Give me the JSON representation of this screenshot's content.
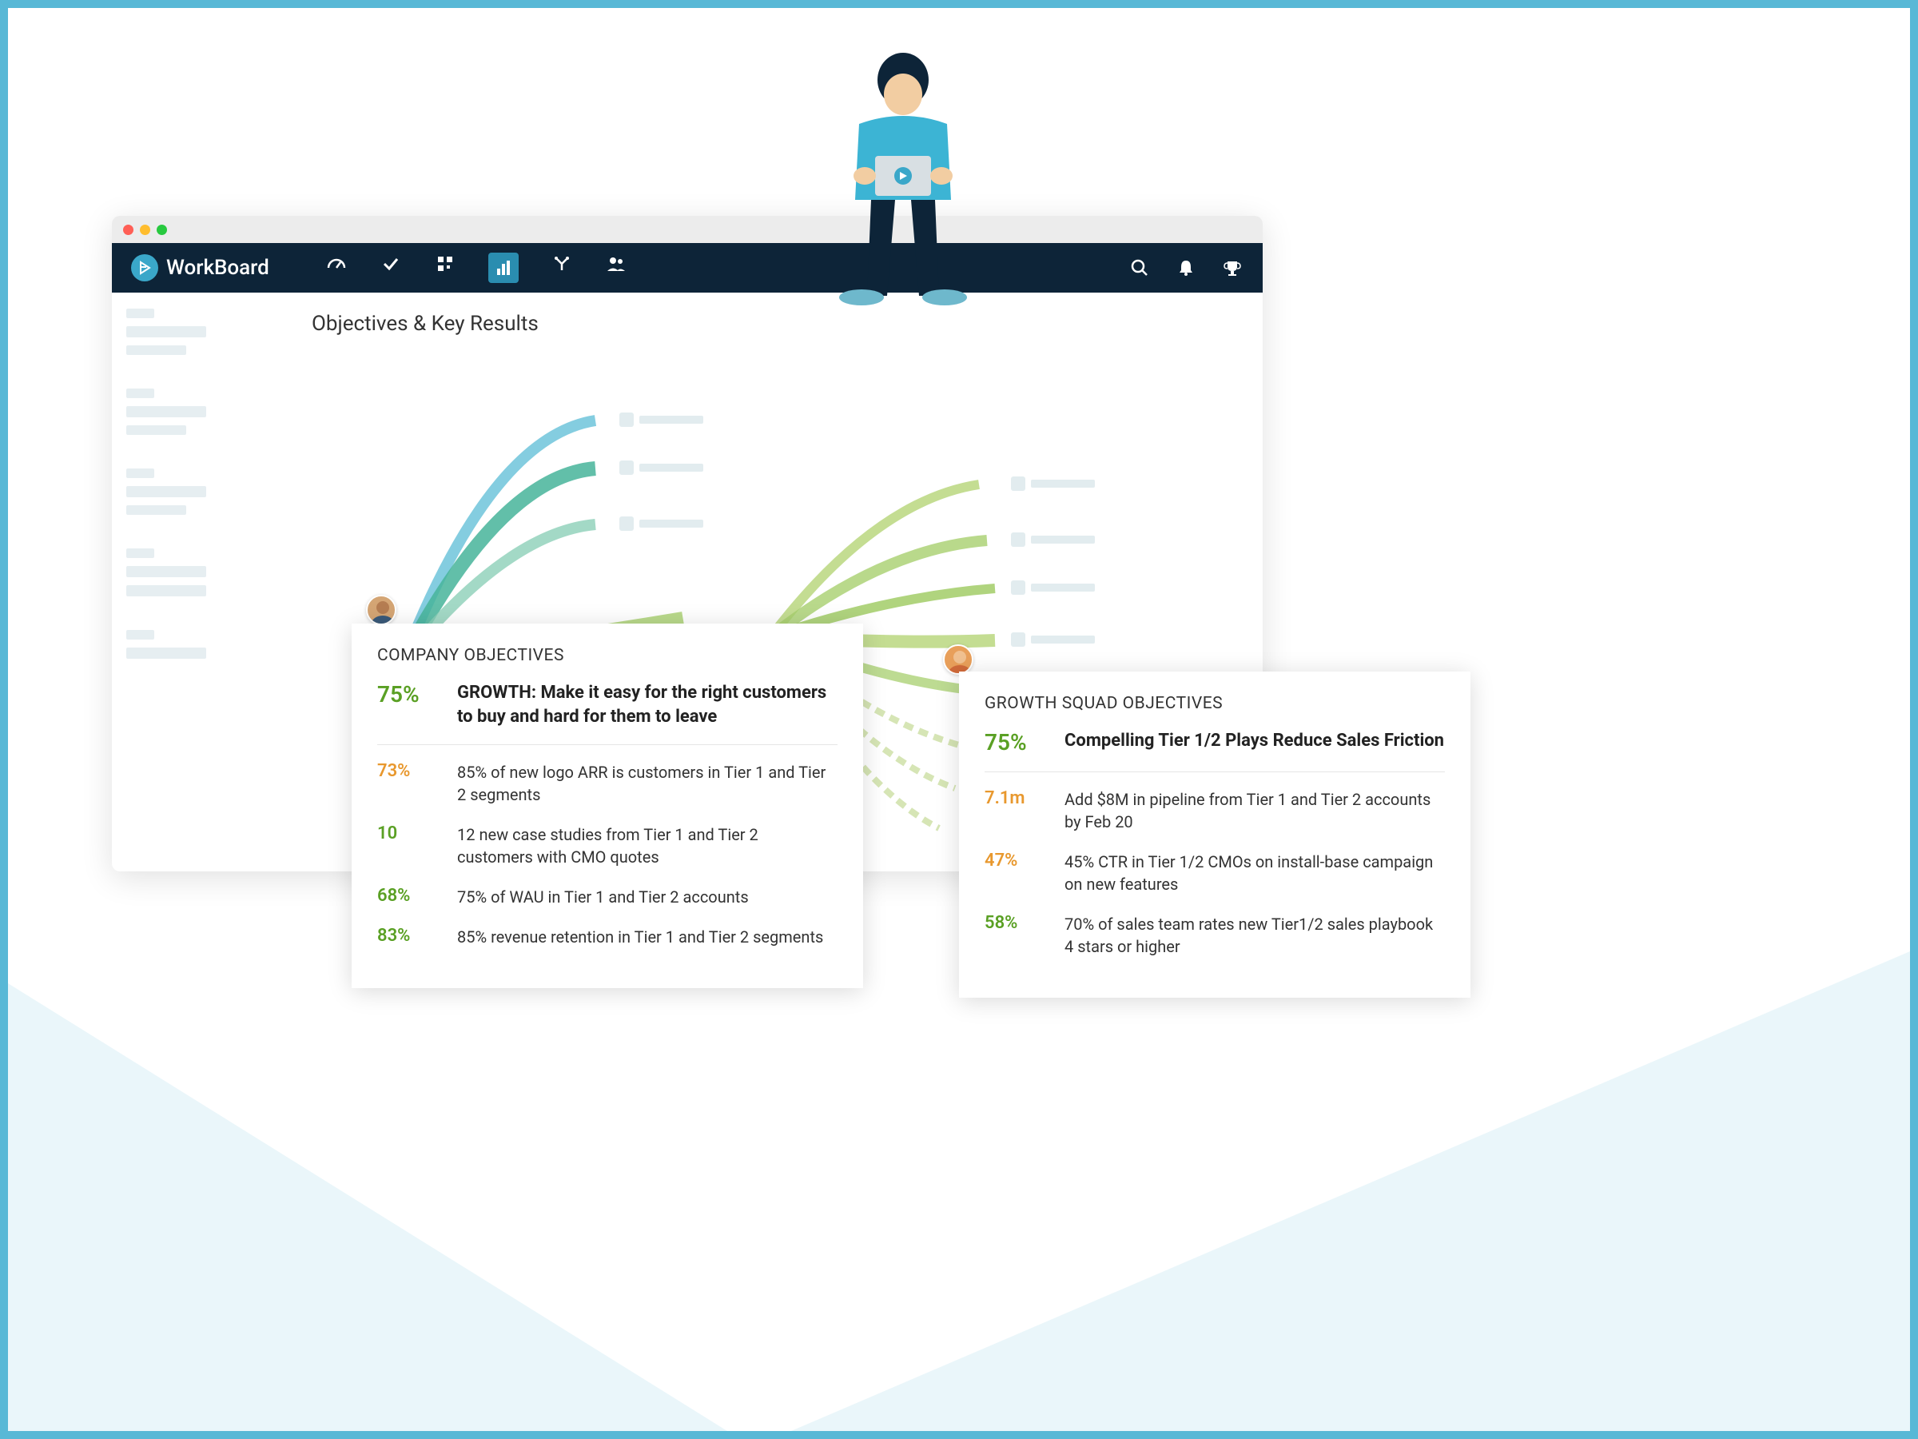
{
  "brand": "WorkBoard",
  "page_title": "Objectives & Key Results",
  "nav": {
    "icons": [
      "speedometer",
      "check",
      "grid",
      "bar-chart",
      "branch",
      "people"
    ],
    "right": [
      "search",
      "bell",
      "trophy"
    ]
  },
  "company_card": {
    "header": "COMPANY OBJECTIVES",
    "objective": {
      "pct": "75%",
      "pct_color": "green",
      "title": "GROWTH: Make it easy for the right customers to buy and hard for them to leave"
    },
    "key_results": [
      {
        "pct": "73%",
        "color": "orange",
        "text": "85% of new logo ARR is customers in Tier 1 and Tier 2 segments"
      },
      {
        "pct": "10",
        "color": "green",
        "text": "12 new case studies from Tier 1 and Tier 2 customers with CMO quotes"
      },
      {
        "pct": "68%",
        "color": "green",
        "text": "75% of WAU in Tier 1 and Tier 2 accounts"
      },
      {
        "pct": "83%",
        "color": "green",
        "text": "85% revenue retention in Tier 1 and Tier 2 segments"
      }
    ]
  },
  "squad_card": {
    "header": "GROWTH SQUAD OBJECTIVES",
    "objective": {
      "pct": "75%",
      "pct_color": "green",
      "title": "Compelling Tier 1/2 Plays Reduce Sales Friction"
    },
    "key_results": [
      {
        "pct": "7.1m",
        "color": "orange",
        "text": "Add $8M in pipeline from Tier 1 and Tier 2 accounts by Feb 20"
      },
      {
        "pct": "47%",
        "color": "orange",
        "text": "45% CTR in Tier 1/2 CMOs  on install-base campaign on new features"
      },
      {
        "pct": "58%",
        "color": "green",
        "text": "70% of sales team rates new Tier1/2 sales playbook 4 stars or higher"
      }
    ]
  }
}
